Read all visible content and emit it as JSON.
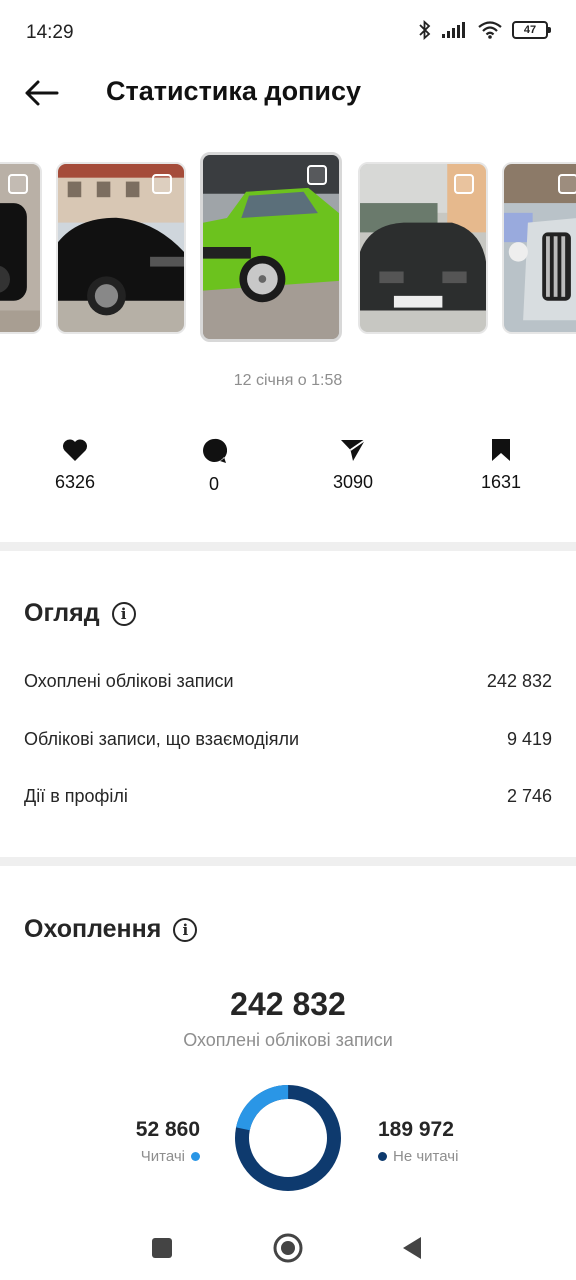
{
  "status_bar": {
    "time": "14:29",
    "battery": "47"
  },
  "header": {
    "title": "Статистика допису"
  },
  "post": {
    "date": "12 січня о 1:58"
  },
  "metrics": [
    {
      "icon": "heart-icon",
      "value": "6326"
    },
    {
      "icon": "comment-icon",
      "value": "0"
    },
    {
      "icon": "share-icon",
      "value": "3090"
    },
    {
      "icon": "bookmark-icon",
      "value": "1631"
    }
  ],
  "overview": {
    "title": "Огляд",
    "rows": [
      {
        "label": "Охоплені облікові записи",
        "value": "242 832"
      },
      {
        "label": "Облікові записи, що взаємодіяли",
        "value": "9 419"
      },
      {
        "label": "Дії в профілі",
        "value": "2 746"
      }
    ]
  },
  "reach": {
    "title": "Охоплення",
    "total": "242 832",
    "subtitle": "Охоплені облікові записи",
    "followers": {
      "value": "52 860",
      "label": "Читачі",
      "color": "#2a96e6",
      "share": 0.218
    },
    "non_followers": {
      "value": "189 972",
      "label": "Не читачі",
      "color": "#0e3a6e",
      "share": 0.782
    }
  },
  "colors": {
    "divider": "#efefef",
    "muted_text": "#8e8e8e"
  }
}
